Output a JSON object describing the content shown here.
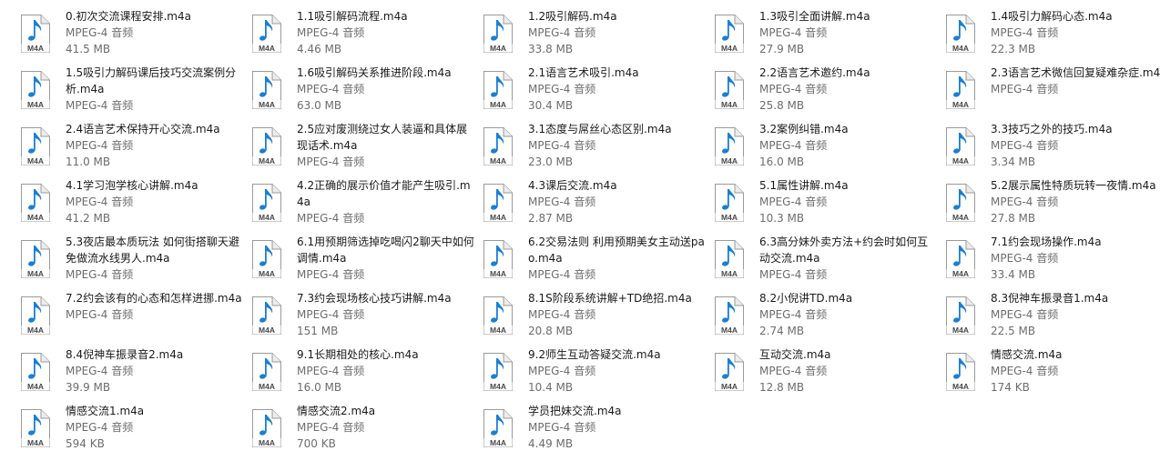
{
  "file_icon": {
    "name": "m4a-file-icon",
    "badge_text": "M4A",
    "note_color": "#1a7fd4",
    "badge_color": "#4a4a4a"
  },
  "files": [
    {
      "name": "0.初次交流课程安排.m4a",
      "type": "MPEG-4 音频",
      "size": "41.5 MB"
    },
    {
      "name": "1.1吸引解码流程.m4a",
      "type": "MPEG-4 音频",
      "size": "4.46 MB"
    },
    {
      "name": "1.2吸引解码.m4a",
      "type": "MPEG-4 音频",
      "size": "33.8 MB"
    },
    {
      "name": "1.3吸引全面讲解.m4a",
      "type": "MPEG-4 音频",
      "size": "27.9 MB"
    },
    {
      "name": "1.4吸引力解码心态.m4a",
      "type": "MPEG-4 音频",
      "size": "22.3 MB"
    },
    {
      "name": "1.5吸引力解码课后技巧交流案例分析.m4a",
      "type": "MPEG-4 音频",
      "size": ""
    },
    {
      "name": "1.6吸引解码关系推进阶段.m4a",
      "type": "MPEG-4 音频",
      "size": "63.0 MB"
    },
    {
      "name": "2.1语言艺术吸引.m4a",
      "type": "MPEG-4 音频",
      "size": "30.4 MB"
    },
    {
      "name": "2.2语言艺术邀约.m4a",
      "type": "MPEG-4 音频",
      "size": "25.8 MB"
    },
    {
      "name": "2.3语言艺术微信回复疑难杂症.m4a",
      "type": "MPEG-4 音频",
      "size": ""
    },
    {
      "name": "2.4语言艺术保持开心交流.m4a",
      "type": "MPEG-4 音频",
      "size": "11.0 MB"
    },
    {
      "name": "2.5应对废测绕过女人装逼和具体展现话术.m4a",
      "type": "MPEG-4 音频",
      "size": ""
    },
    {
      "name": "3.1态度与屌丝心态区别.m4a",
      "type": "MPEG-4 音频",
      "size": "23.0 MB"
    },
    {
      "name": "3.2案例纠错.m4a",
      "type": "MPEG-4 音频",
      "size": "16.0 MB"
    },
    {
      "name": "3.3技巧之外的技巧.m4a",
      "type": "MPEG-4 音频",
      "size": "3.34 MB"
    },
    {
      "name": "4.1学习泡学核心讲解.m4a",
      "type": "MPEG-4 音频",
      "size": "41.2 MB"
    },
    {
      "name": "4.2正确的展示价值才能产生吸引.m4a",
      "type": "MPEG-4 音频",
      "size": ""
    },
    {
      "name": "4.3课后交流.m4a",
      "type": "MPEG-4 音频",
      "size": "2.87 MB"
    },
    {
      "name": "5.1属性讲解.m4a",
      "type": "MPEG-4 音频",
      "size": "10.3 MB"
    },
    {
      "name": "5.2展示属性特质玩转一夜情.m4a",
      "type": "MPEG-4 音频",
      "size": "27.8 MB"
    },
    {
      "name": "5.3夜店最本质玩法 如何街搭聊天避免做流水线男人.m4a",
      "type": "MPEG-4 音频",
      "size": ""
    },
    {
      "name": "6.1用预期筛选掉吃喝闪2聊天中如何调情.m4a",
      "type": "MPEG-4 音频",
      "size": ""
    },
    {
      "name": "6.2交易法则 利用预期美女主动送pao.m4a",
      "type": "MPEG-4 音频",
      "size": ""
    },
    {
      "name": "6.3高分妹外卖方法+约会时如何互动交流.m4a",
      "type": "MPEG-4 音频",
      "size": ""
    },
    {
      "name": "7.1约会现场操作.m4a",
      "type": "MPEG-4 音频",
      "size": "33.4 MB"
    },
    {
      "name": "7.2约会该有的心态和怎样进挪.m4a",
      "type": "MPEG-4 音频",
      "size": ""
    },
    {
      "name": "7.3约会现场核心技巧讲解.m4a",
      "type": "MPEG-4 音频",
      "size": "151 MB"
    },
    {
      "name": "8.1S阶段系统讲解+TD绝招.m4a",
      "type": "MPEG-4 音频",
      "size": "20.8 MB"
    },
    {
      "name": "8.2小倪讲TD.m4a",
      "type": "MPEG-4 音频",
      "size": "2.74 MB"
    },
    {
      "name": "8.3倪神车振录音1.m4a",
      "type": "MPEG-4 音频",
      "size": "22.5 MB"
    },
    {
      "name": "8.4倪神车振录音2.m4a",
      "type": "MPEG-4 音频",
      "size": "39.9 MB"
    },
    {
      "name": "9.1长期相处的核心.m4a",
      "type": "MPEG-4 音频",
      "size": "16.0 MB"
    },
    {
      "name": "9.2师生互动答疑交流.m4a",
      "type": "MPEG-4 音频",
      "size": "10.4 MB"
    },
    {
      "name": "互动交流.m4a",
      "type": "MPEG-4 音频",
      "size": "12.8 MB"
    },
    {
      "name": "情感交流.m4a",
      "type": "MPEG-4 音频",
      "size": "174 KB"
    },
    {
      "name": "情感交流1.m4a",
      "type": "MPEG-4 音频",
      "size": "594 KB"
    },
    {
      "name": "情感交流2.m4a",
      "type": "MPEG-4 音频",
      "size": "700 KB"
    },
    {
      "name": "学员把妹交流.m4a",
      "type": "MPEG-4 音频",
      "size": "4.49 MB"
    }
  ]
}
